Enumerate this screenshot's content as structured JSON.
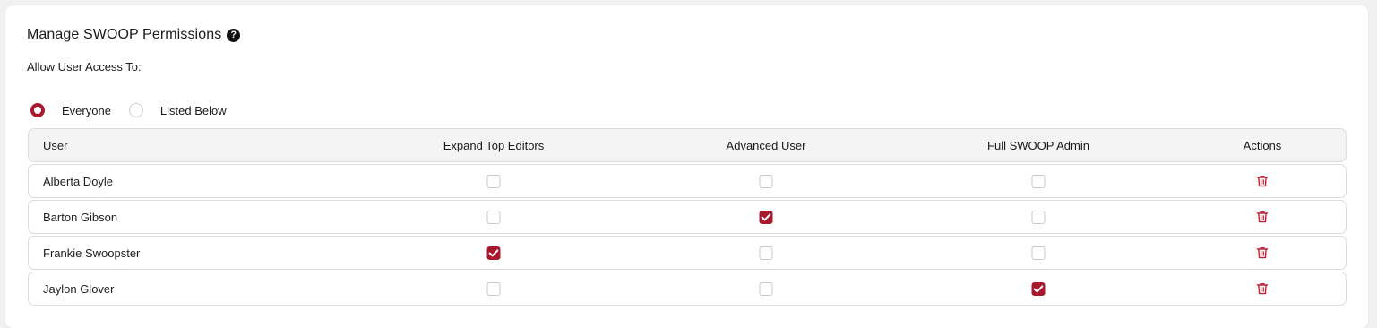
{
  "title": "Manage SWOOP Permissions",
  "help_icon": "question-circle-icon",
  "access_label": "Allow User Access To:",
  "radio_options": [
    {
      "label": "Everyone",
      "checked": true
    },
    {
      "label": "Listed Below",
      "checked": false
    }
  ],
  "table": {
    "headers": [
      "User",
      "Expand Top Editors",
      "Advanced User",
      "Full SWOOP Admin",
      "Actions"
    ],
    "rows": [
      {
        "user": "Alberta Doyle",
        "expand_top_editors": false,
        "advanced_user": false,
        "full_admin": false
      },
      {
        "user": "Barton Gibson",
        "expand_top_editors": false,
        "advanced_user": true,
        "full_admin": false
      },
      {
        "user": "Frankie Swoopster",
        "expand_top_editors": true,
        "advanced_user": false,
        "full_admin": false
      },
      {
        "user": "Jaylon Glover",
        "expand_top_editors": false,
        "advanced_user": false,
        "full_admin": true
      }
    ],
    "action_icon": "trash-icon"
  },
  "colors": {
    "accent": "#a8192e",
    "background": "#f1f1f1",
    "card": "#ffffff",
    "header_row": "#f4f4f4"
  }
}
